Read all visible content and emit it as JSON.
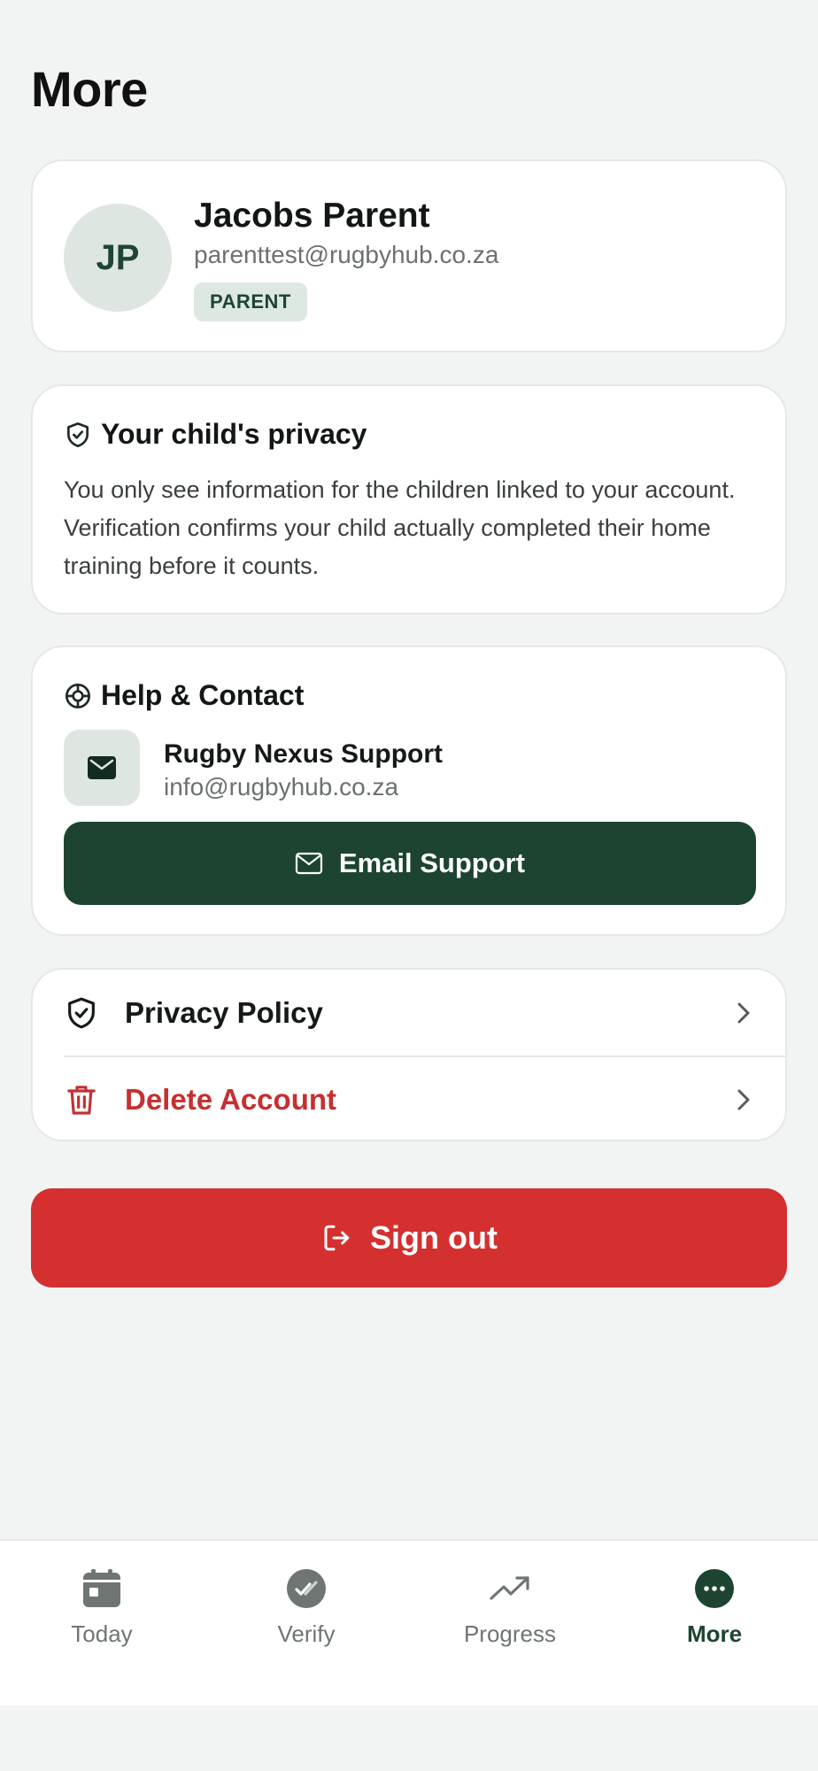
{
  "header": {
    "title": "More"
  },
  "profile": {
    "initials": "JP",
    "name": "Jacobs Parent",
    "email": "parenttest@rugbyhub.co.za",
    "role": "PARENT"
  },
  "privacy": {
    "icon": "shield-check-icon",
    "title": "Your child's privacy",
    "text": "You only see information for the children linked to your account. Verification confirms your child actually completed their home training before it counts."
  },
  "help": {
    "icon": "lifebuoy-icon",
    "title": "Help & Contact",
    "support_name": "Rugby Nexus Support",
    "support_email": "info@rugbyhub.co.za",
    "button_label": "Email Support"
  },
  "links": [
    {
      "label": "Privacy Policy",
      "icon": "shield-check-icon"
    },
    {
      "label": "Delete Account",
      "icon": "trash-icon"
    }
  ],
  "signout": {
    "label": "Sign out",
    "icon": "logout-icon"
  },
  "nav": [
    {
      "label": "Today",
      "icon": "calendar-icon"
    },
    {
      "label": "Verify",
      "icon": "check-circle-icon"
    },
    {
      "label": "Progress",
      "icon": "trending-up-icon"
    },
    {
      "label": "More",
      "icon": "more-dots-icon",
      "active": true
    }
  ],
  "colors": {
    "brand_green": "#1c4431",
    "danger_red": "#d43030",
    "background": "#f2f4f3"
  }
}
